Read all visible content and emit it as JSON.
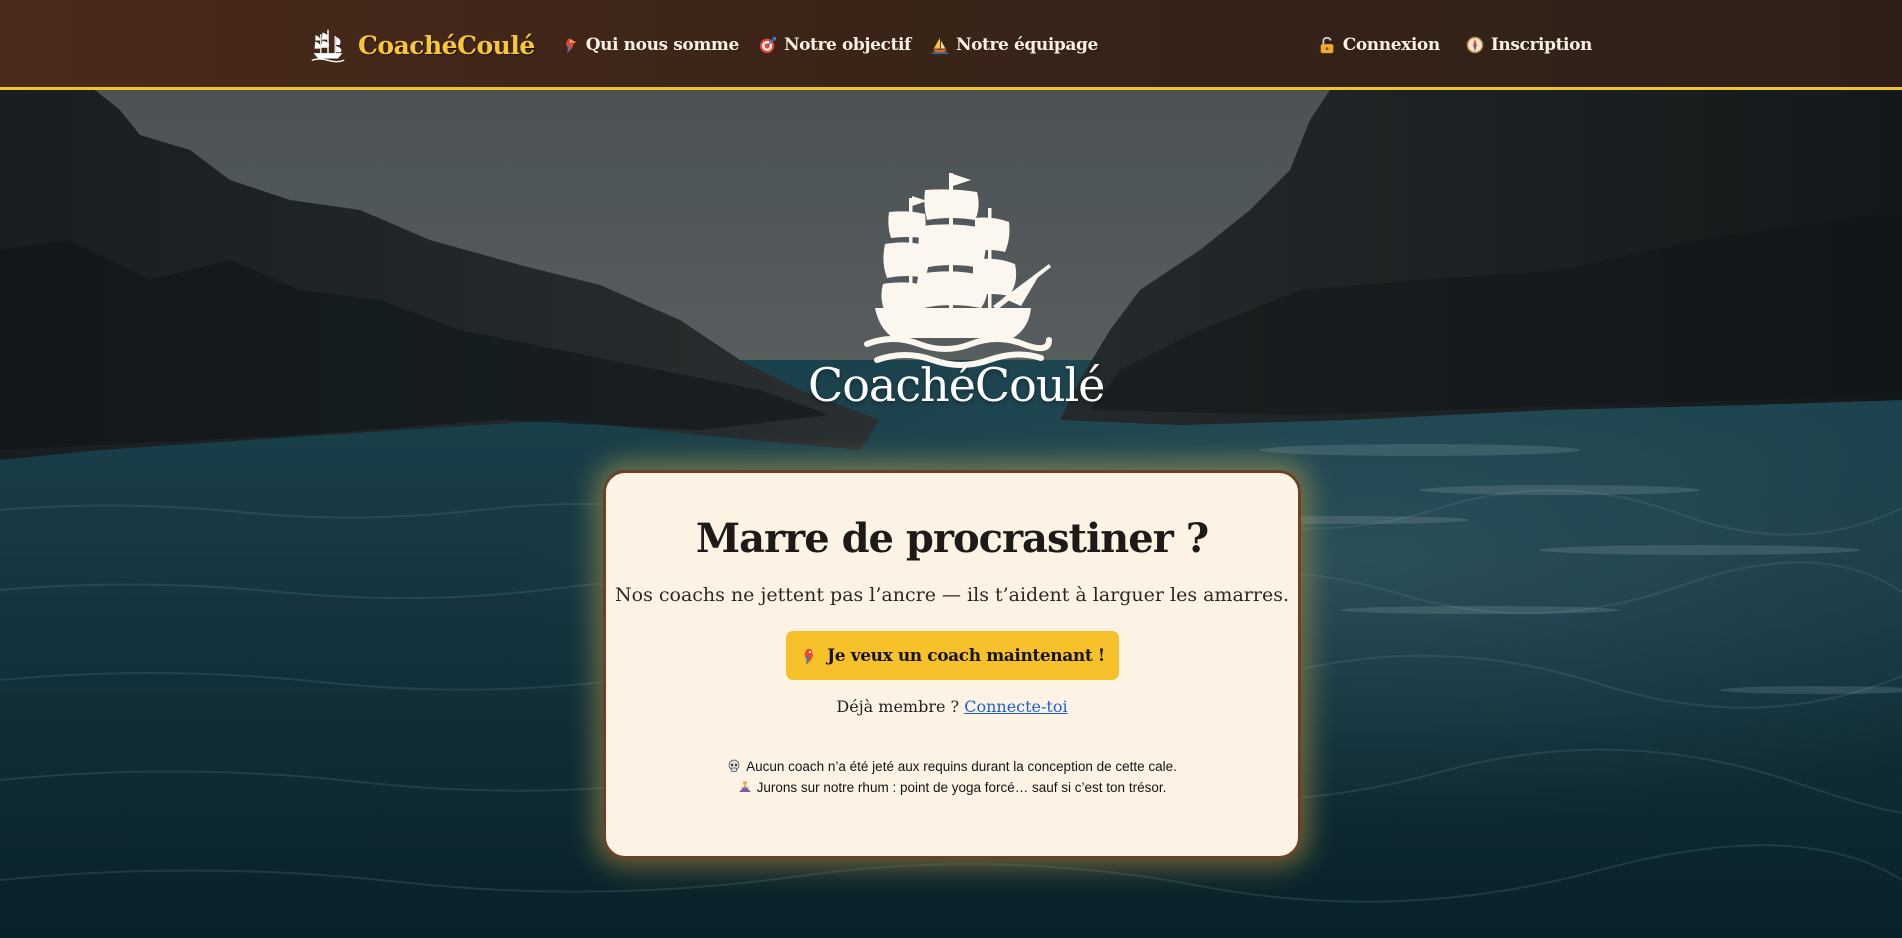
{
  "nav": {
    "brand": "CoachéCoulé",
    "brand_icon": "ship-icon",
    "links": [
      {
        "label": "Qui nous somme",
        "icon": "parrot-icon"
      },
      {
        "label": "Notre objectif",
        "icon": "target-icon"
      },
      {
        "label": "Notre équipage",
        "icon": "sailboat-icon"
      }
    ],
    "auth": [
      {
        "label": "Connexion",
        "icon": "unlock-icon"
      },
      {
        "label": "Inscription",
        "icon": "compass-icon"
      }
    ]
  },
  "hero": {
    "logo_text": "CoachéCoulé",
    "logo_icon": "ship-icon"
  },
  "card": {
    "title": "Marre de procrastiner ?",
    "subtitle": "Nos coachs ne jettent pas l’ancre — ils t’aident à larguer les amarres.",
    "cta_label": "Je veux un coach maintenant !",
    "cta_icon": "parrot-icon",
    "member_prefix": "Déjà membre ?",
    "member_link": "Connecte-toi",
    "notes": [
      {
        "icon": "skull-icon",
        "text": "Aucun coach n’a été jeté aux requins durant la conception de cette cale."
      },
      {
        "icon": "meditation-icon",
        "text": "Jurons sur notre rhum : point de yoga forcé… sauf si c’est ton trésor."
      }
    ]
  },
  "colors": {
    "accent": "#f6c12b",
    "nav_bg": "#3a2418",
    "card_bg": "#fdf3e4",
    "card_border": "#6b4129",
    "link": "#1a5fd6"
  }
}
